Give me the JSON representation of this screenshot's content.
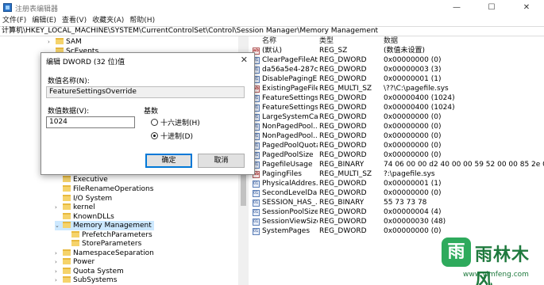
{
  "window": {
    "title": "注册表编辑器",
    "minimize": "—",
    "maximize": "☐",
    "close": "✕"
  },
  "menu": [
    "文件(F)",
    "编辑(E)",
    "查看(V)",
    "收藏夹(A)",
    "帮助(H)"
  ],
  "address": "计算机\\HKEY_LOCAL_MACHINE\\SYSTEM\\CurrentControlSet\\Control\\Session Manager\\Memory Management",
  "tree": {
    "top_items": [
      {
        "label": "SAM",
        "arrow": "›"
      },
      {
        "label": "ScEvents",
        "arrow": ""
      }
    ],
    "items": [
      {
        "label": "Executive",
        "arrow": ""
      },
      {
        "label": "FileRenameOperations",
        "arrow": ""
      },
      {
        "label": "I/O System",
        "arrow": ""
      },
      {
        "label": "kernel",
        "arrow": "›"
      },
      {
        "label": "KnownDLLs",
        "arrow": ""
      },
      {
        "label": "Memory Management",
        "arrow": "⌄"
      },
      {
        "label": "PrefetchParameters",
        "arrow": ""
      },
      {
        "label": "StoreParameters",
        "arrow": ""
      },
      {
        "label": "NamespaceSeparation",
        "arrow": "›"
      },
      {
        "label": "Power",
        "arrow": "›"
      },
      {
        "label": "Quota System",
        "arrow": "›"
      },
      {
        "label": "SubSystems",
        "arrow": "›"
      }
    ]
  },
  "values": {
    "headers": {
      "name": "名称",
      "type": "类型",
      "data": "数据"
    },
    "rows": [
      {
        "name": "(默认)",
        "type": "REG_SZ",
        "data": "(数值未设置)",
        "icon": "ab"
      },
      {
        "name": "ClearPageFileAt...",
        "type": "REG_DWORD",
        "data": "0x00000000 (0)",
        "icon": "011"
      },
      {
        "name": "da56a5e4-287c...",
        "type": "REG_DWORD",
        "data": "0x00000003 (3)",
        "icon": "011"
      },
      {
        "name": "DisablePagingE...",
        "type": "REG_DWORD",
        "data": "0x00000001 (1)",
        "icon": "011"
      },
      {
        "name": "ExistingPageFiles",
        "type": "REG_MULTI_SZ",
        "data": "\\??\\C:\\pagefile.sys",
        "icon": "ab"
      },
      {
        "name": "FeatureSettings...",
        "type": "REG_DWORD",
        "data": "0x00000400 (1024)",
        "icon": "011"
      },
      {
        "name": "FeatureSettings...",
        "type": "REG_DWORD",
        "data": "0x00000400 (1024)",
        "icon": "011"
      },
      {
        "name": "LargeSystemCa...",
        "type": "REG_DWORD",
        "data": "0x00000000 (0)",
        "icon": "011"
      },
      {
        "name": "NonPagedPool...",
        "type": "REG_DWORD",
        "data": "0x00000000 (0)",
        "icon": "011"
      },
      {
        "name": "NonPagedPool...",
        "type": "REG_DWORD",
        "data": "0x00000000 (0)",
        "icon": "011"
      },
      {
        "name": "PagedPoolQuota",
        "type": "REG_DWORD",
        "data": "0x00000000 (0)",
        "icon": "011"
      },
      {
        "name": "PagedPoolSize",
        "type": "REG_DWORD",
        "data": "0x00000000 (0)",
        "icon": "011"
      },
      {
        "name": "PagefileUsage",
        "type": "REG_BINARY",
        "data": "74 06 00 00 d2 40 00 00 59 52 00 00 85 2e 00 0...",
        "icon": "011"
      },
      {
        "name": "PagingFiles",
        "type": "REG_MULTI_SZ",
        "data": "?:\\pagefile.sys",
        "icon": "ab"
      },
      {
        "name": "PhysicalAddres...",
        "type": "REG_DWORD",
        "data": "0x00000001 (1)",
        "icon": "011"
      },
      {
        "name": "SecondLevelDa...",
        "type": "REG_DWORD",
        "data": "0x00000000 (0)",
        "icon": "011"
      },
      {
        "name": "SESSION_HAS_...",
        "type": "REG_BINARY",
        "data": "55 73 73 78",
        "icon": "011"
      },
      {
        "name": "SessionPoolSize",
        "type": "REG_DWORD",
        "data": "0x00000004 (4)",
        "icon": "011"
      },
      {
        "name": "SessionViewSize",
        "type": "REG_DWORD",
        "data": "0x00000030 (48)",
        "icon": "011"
      },
      {
        "name": "SystemPages",
        "type": "REG_DWORD",
        "data": "0x00000000 (0)",
        "icon": "011"
      }
    ]
  },
  "dialog": {
    "title": "编辑 DWORD (32 位)值",
    "close": "✕",
    "name_label": "数值名称(N):",
    "name_value": "FeatureSettingsOverride",
    "data_label": "数值数据(V):",
    "data_value": "1024",
    "base_label": "基数",
    "hex_label": "十六进制(H)",
    "dec_label": "十进制(D)",
    "selected_base": "decimal",
    "ok": "确定",
    "cancel": "取消"
  },
  "watermark": {
    "logo_char": "雨",
    "title": "雨林木风",
    "url": "www.ylmfeng.com"
  },
  "colors": {
    "selection": "#cce8ff",
    "accent": "#0078d7",
    "folder": "#f5d36b",
    "watermark": "#1f7a3e"
  }
}
